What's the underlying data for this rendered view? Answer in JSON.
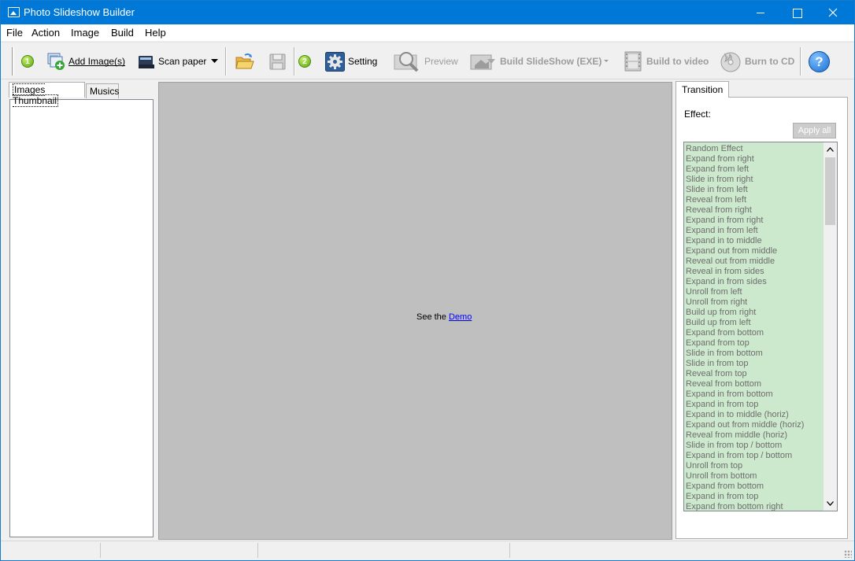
{
  "window": {
    "title": "Photo Slideshow Builder"
  },
  "menu": {
    "items": [
      "File",
      "Action",
      "Image",
      "Build",
      "Help"
    ]
  },
  "toolbar": {
    "step1": "1",
    "add_images": "Add Image(s)",
    "scan_paper": "Scan paper",
    "step2": "2",
    "setting": "Setting",
    "preview": "Preview",
    "build_slideshow": "Build SlideShow (EXE)",
    "build_video": "Build to video",
    "burn_cd": "Burn to CD",
    "help_glyph": "?"
  },
  "left": {
    "tabs": [
      "Images Thumbnail",
      "Musics"
    ]
  },
  "center": {
    "prefix": "See the ",
    "link": "Demo"
  },
  "right": {
    "tab": "Transition",
    "effect_label": "Effect:",
    "apply_all": "Apply all",
    "effects": [
      "Random Effect",
      "Expand from right",
      "Expand from left",
      "Slide in from right",
      "Slide in from left",
      "Reveal from left",
      "Reveal from right",
      "Expand in from right",
      "Expand in from left",
      "Expand in to middle",
      "Expand out from middle",
      "Reveal out from middle",
      "Reveal in from sides",
      "Expand in from sides",
      "Unroll from left",
      "Unroll from right",
      "Build up from right",
      "Build up from left",
      "Expand from bottom",
      "Expand from top",
      "Slide in from bottom",
      "Slide in from top",
      "Reveal from top",
      "Reveal from bottom",
      "Expand in from bottom",
      "Expand in from top",
      "Expand in to middle (horiz)",
      "Expand out from middle (horiz)",
      "Reveal from middle (horiz)",
      "Slide in from top / bottom",
      "Expand in from top / bottom",
      "Unroll from top",
      "Unroll from bottom",
      "Expand from bottom",
      "Expand in from top",
      "Expand from bottom right"
    ]
  },
  "colors": {
    "titlebar": "#0078d7",
    "list_bg": "#cde9cd",
    "canvas_bg": "#bfbfbf"
  }
}
